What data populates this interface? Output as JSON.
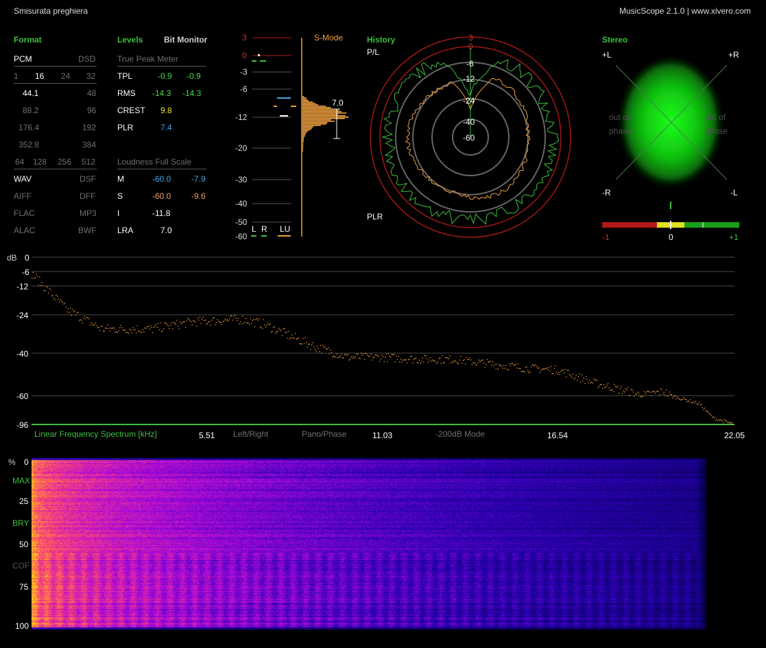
{
  "header": {
    "track_title": "Smisurata preghiera",
    "app_title": "MusicScope 2.1.0 | www.xivero.com"
  },
  "format": {
    "heading": "Format",
    "pcm_label": "PCM",
    "dsd_label": "DSD",
    "bits": [
      "1",
      "16",
      "24",
      "32"
    ],
    "rates": [
      {
        "pcm": "44.1",
        "dsd": "48"
      },
      {
        "pcm": "88.2",
        "dsd": "96"
      },
      {
        "pcm": "176.4",
        "dsd": "192"
      },
      {
        "pcm": "352.8",
        "dsd": "384"
      }
    ],
    "dsd_rates": [
      "64",
      "128",
      "256",
      "512"
    ],
    "containers": [
      {
        "left": "WAV",
        "right": "DSF"
      },
      {
        "left": "AIFF",
        "right": "DFF"
      },
      {
        "left": "FLAC",
        "right": "MP3"
      },
      {
        "left": "ALAC",
        "right": "BWF"
      }
    ]
  },
  "levels": {
    "heading": "Levels",
    "bit_monitor": "Bit Monitor",
    "true_peak_title": "True Peak Meter",
    "rows": [
      {
        "label": "TPL",
        "l": "-0.9",
        "r": "-0.9"
      },
      {
        "label": "RMS",
        "l": "-14.3",
        "r": "-14.3"
      },
      {
        "label": "CREST",
        "l": "9.8"
      },
      {
        "label": "PLR",
        "l": "7.4"
      }
    ],
    "loudness_title": "Loudness Full Scale",
    "loudness": [
      {
        "label": "M",
        "a": "-60.0",
        "b": "-7.9"
      },
      {
        "label": "S",
        "a": "-60.0",
        "b": "-9.6"
      },
      {
        "label": "I",
        "a": "-11.8"
      },
      {
        "label": "LRA",
        "a": "7.0"
      }
    ]
  },
  "meter": {
    "mode_label": "S-Mode",
    "scale": [
      "3",
      "0",
      "-3",
      "-6",
      "-12",
      "-20",
      "-30",
      "-40",
      "-50",
      "-60"
    ],
    "channels": [
      "L",
      "R",
      "LU"
    ],
    "lra_value": "7.0"
  },
  "history": {
    "heading": "History",
    "pl_label": "P/L",
    "plr_label": "PLR",
    "rings": [
      "3",
      "0",
      "-6",
      "-12",
      "-24",
      "-40",
      "-60"
    ]
  },
  "stereo": {
    "heading": "Stereo",
    "corners": {
      "tl": "+L",
      "tr": "+R",
      "bl": "-R",
      "br": "-L"
    },
    "phase_left": [
      "out of",
      "phase"
    ],
    "phase_right": [
      "out of",
      "phase"
    ],
    "correlation": {
      "min": "-1",
      "mid": "0",
      "max": "+1",
      "value": 0.1
    }
  },
  "spectrum": {
    "db_label": "dB",
    "db_ticks": [
      "0",
      "-6",
      "-12",
      "-24",
      "-40",
      "-60",
      "-96"
    ],
    "title": "Linear Frequency Spectrum [kHz]",
    "freq_ticks": [
      "5.51",
      "11.03",
      "16.54",
      "22.05"
    ],
    "modes": [
      "Left/Right",
      "Pano/Phase",
      "-200dB Mode"
    ]
  },
  "spectrogram": {
    "ticks": [
      "%",
      "0",
      "MAX",
      "25",
      "BRY",
      "50",
      "COF",
      "75",
      "100"
    ]
  },
  "colors": {
    "accent_green": "#3fbf3f",
    "meter_orange": "#f0a040",
    "ring_red": "#b01818",
    "value_green": "#4ddc4d",
    "value_blue": "#4aa6e6",
    "value_orange": "#f0a060"
  }
}
